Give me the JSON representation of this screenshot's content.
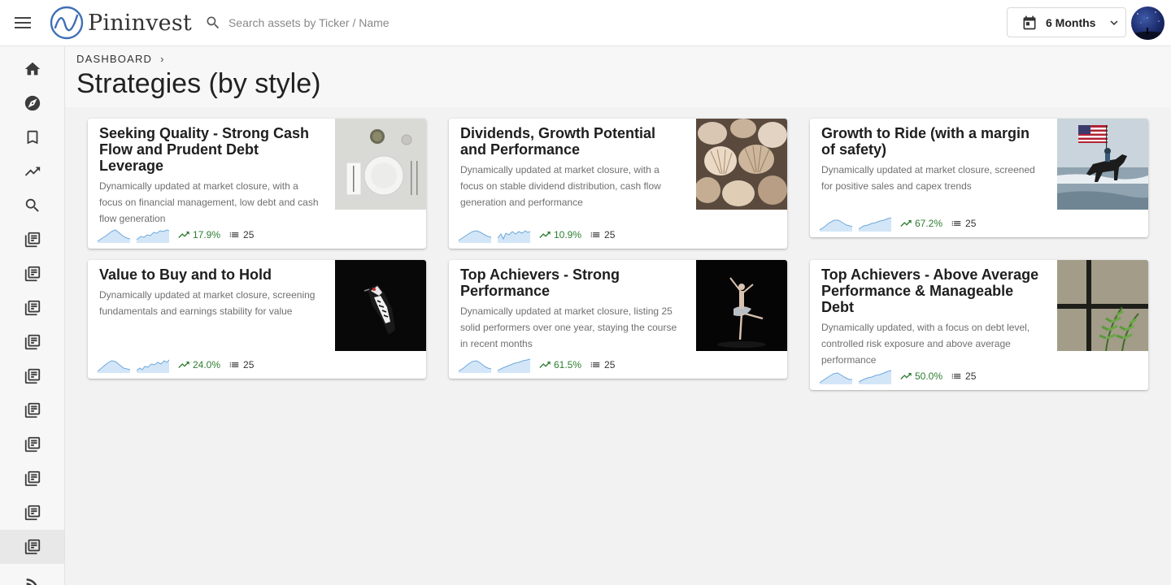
{
  "app": {
    "name": "Pininvest"
  },
  "search": {
    "placeholder": "Search assets by Ticker / Name"
  },
  "period": {
    "label": "6 Months"
  },
  "breadcrumb": {
    "root": "DASHBOARD",
    "separator": "›"
  },
  "page": {
    "title": "Strategies (by style)"
  },
  "colors": {
    "accent": "#1565c0",
    "positive": "#2e7d32",
    "spark_fill": "#d3e6f8",
    "spark_stroke": "#6ea8dc"
  },
  "sidebar": {
    "items": [
      {
        "icon": "home-icon"
      },
      {
        "icon": "compass-icon"
      },
      {
        "icon": "bookmark-icon"
      },
      {
        "icon": "trending-up-icon"
      },
      {
        "icon": "search-icon"
      },
      {
        "icon": "library-icon"
      },
      {
        "icon": "library-icon"
      },
      {
        "icon": "library-icon"
      },
      {
        "icon": "library-icon"
      },
      {
        "icon": "library-icon"
      },
      {
        "icon": "library-icon"
      },
      {
        "icon": "library-icon"
      },
      {
        "icon": "library-icon"
      },
      {
        "icon": "library-icon"
      },
      {
        "icon": "library-icon",
        "active": true
      },
      {
        "icon": "rss-icon"
      }
    ]
  },
  "cards": [
    {
      "title": "Seeking Quality - Strong Cash Flow and Prudent Debt Leverage",
      "description": "Dynamically updated at market closure, with a focus on financial management, low debt and cash flow generation",
      "return": "17.9%",
      "count": "25",
      "image": "table-setting"
    },
    {
      "title": "Dividends, Growth Potential and Performance",
      "description": "Dynamically updated at market closure, with a focus on stable dividend distribution, cash flow generation and performance",
      "return": "10.9%",
      "count": "25",
      "image": "seashells"
    },
    {
      "title": "Growth to Ride (with a margin of safety)",
      "description": "Dynamically updated at market closure, screened for positive sales and capex trends",
      "return": "67.2%",
      "count": "25",
      "image": "horse-rider-flag"
    },
    {
      "title": "Value to Buy and to Hold",
      "description": "Dynamically updated at market closure, screening fundamentals and earnings stability for value",
      "return": "24.0%",
      "count": "25",
      "image": "woodpecker"
    },
    {
      "title": "Top Achievers - Strong Performance",
      "description": "Dynamically updated at market closure, listing 25 solid performers over one year, staying the course in recent months",
      "return": "61.5%",
      "count": "25",
      "image": "ballerina"
    },
    {
      "title": "Top Achievers - Above Average Performance & Manageable Debt",
      "description": "Dynamically updated, with a focus on debt level, controlled risk exposure and above average performance",
      "return": "50.0%",
      "count": "25",
      "image": "fern-window"
    }
  ]
}
